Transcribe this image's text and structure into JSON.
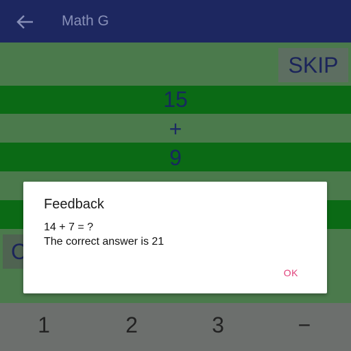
{
  "app_bar": {
    "title": "Math G",
    "back_icon": "arrow-left-icon"
  },
  "main": {
    "skip_label": "SKIP",
    "operand1": "15",
    "operator": "+",
    "operand2": "9",
    "partial_button_label": "C"
  },
  "keypad": {
    "keys": [
      "1",
      "2",
      "3",
      "−"
    ]
  },
  "dialog": {
    "title": "Feedback",
    "line1": "14 + 7 = ?",
    "line2": "The correct answer is 21",
    "ok_label": "OK"
  },
  "colors": {
    "app_bar": "#1d2760",
    "background": "#4b7a4c",
    "band_dark": "#0b6a15",
    "ok_accent": "#e0407a"
  }
}
